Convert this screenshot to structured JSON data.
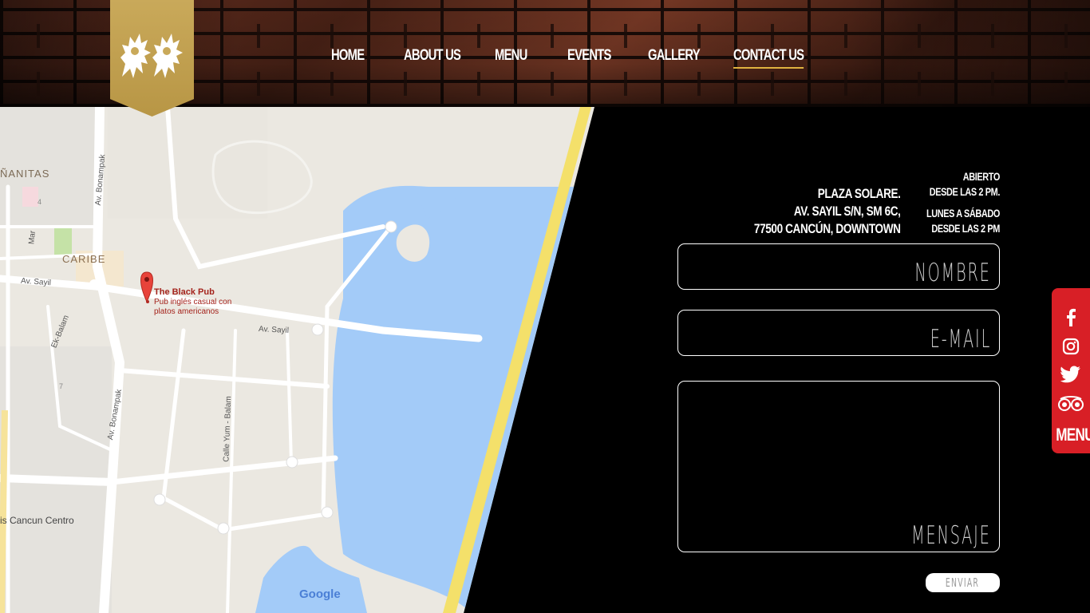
{
  "nav": {
    "items": [
      {
        "label": "HOME"
      },
      {
        "label": "ABOUT US"
      },
      {
        "label": "MENU"
      },
      {
        "label": "EVENTS"
      },
      {
        "label": "GALLERY"
      },
      {
        "label": "CONTACT US",
        "active": true
      }
    ]
  },
  "map": {
    "pin_title": "The Black Pub",
    "pin_desc_1": "Pub inglés casual con",
    "pin_desc_2": "platos americanos",
    "labels": {
      "canitas": "ÑANITAS",
      "caribe": "CARIBE",
      "av_sayil_1": "Av. Sayil",
      "av_sayil_2": "Av. Sayil",
      "bonampak_1": "Av. Bonampak",
      "bonampak_2": "Av. Bonampak",
      "mar": "Mar",
      "ek_balam": "Ek-Balam",
      "yum_balam": "Calle Yum - Balam",
      "cancun_centro": "is Cancun Centro",
      "num_4": "4",
      "num_7": "7",
      "google": "Google"
    }
  },
  "address": {
    "line1": "PLAZA SOLARE.",
    "line2": "AV. SAYIL S/N, SM 6C,",
    "line3": "77500 CANCÚN, DOWNTOWN"
  },
  "hours": {
    "line1": "ABIERTO",
    "line2": "DESDE LAS 2 PM.",
    "line3": "LUNES A SÁBADO",
    "line4": "DESDE LAS 2 PM"
  },
  "form": {
    "name_placeholder": "NOMBRE",
    "email_placeholder": "E-MAIL",
    "message_placeholder": "MENSAJE",
    "submit_label": "ENVIAR"
  },
  "social": {
    "icons": [
      "facebook-icon",
      "instagram-icon",
      "twitter-icon",
      "tripadvisor-icon"
    ],
    "menu_label": "MENU"
  },
  "colors": {
    "accent_gold": "#c9a95a",
    "stripe_yellow": "#f4e06a",
    "social_red": "#d81f26",
    "water": "#a3cbf8"
  }
}
